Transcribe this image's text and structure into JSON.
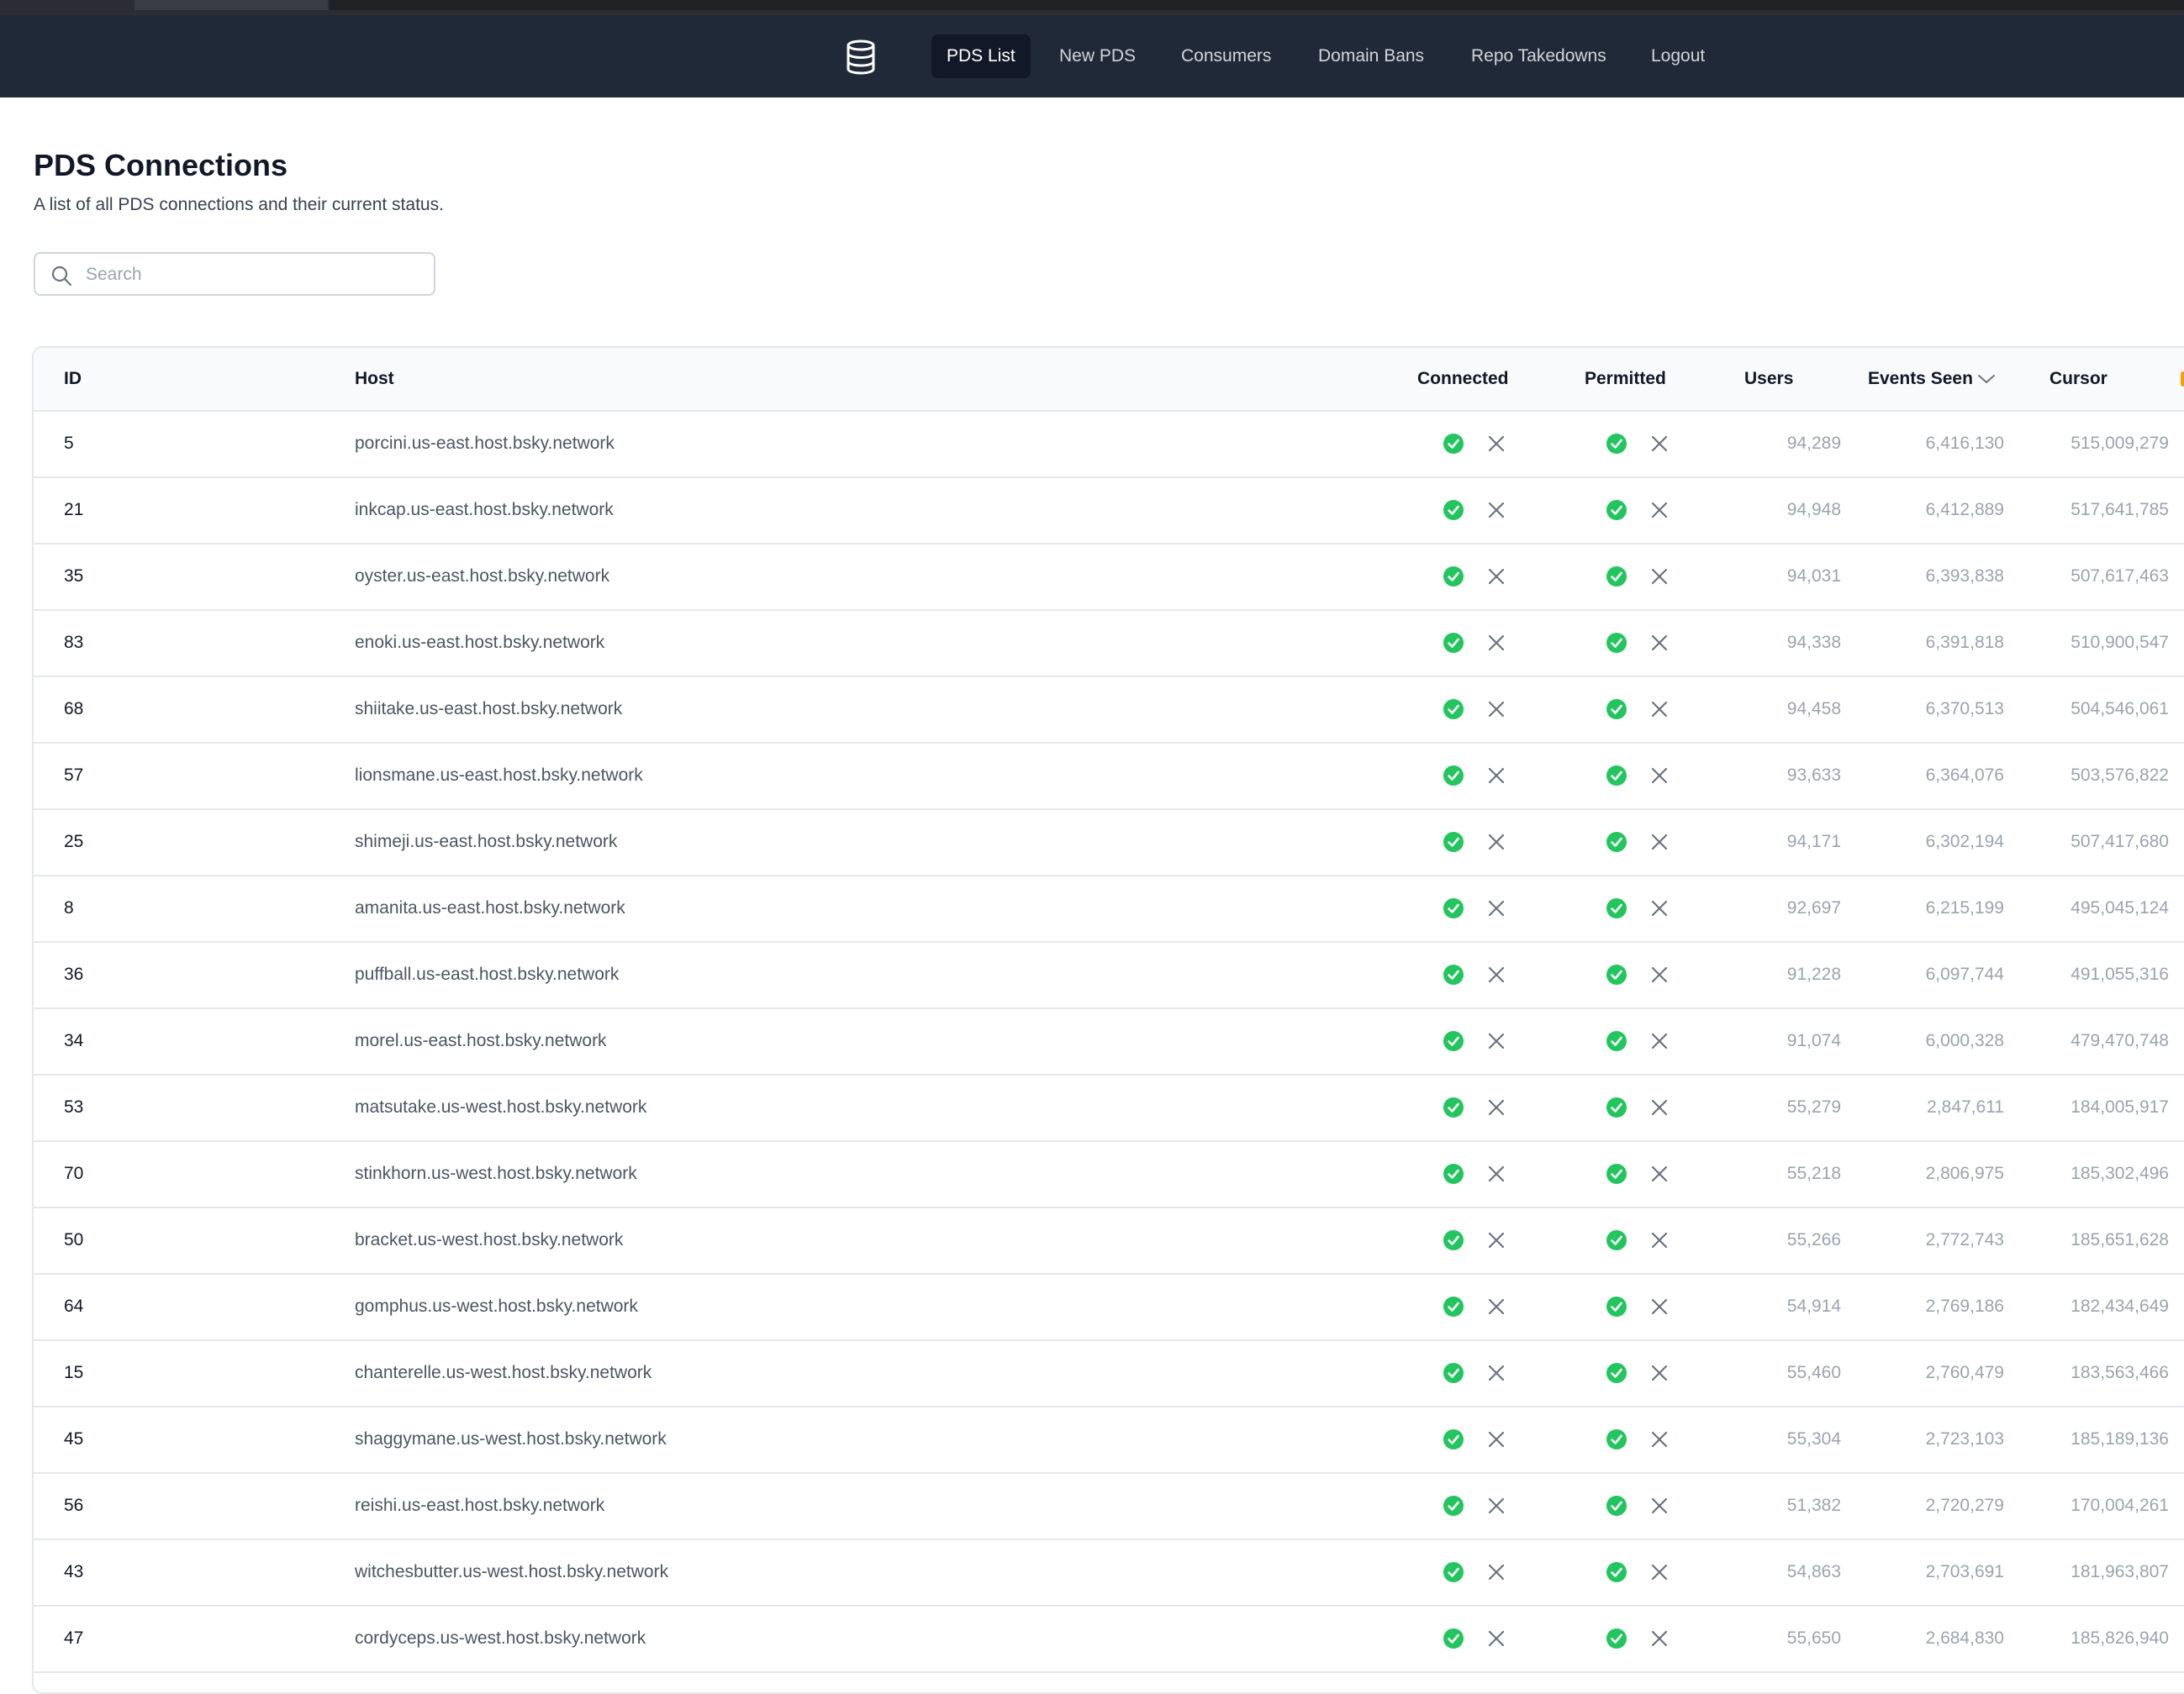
{
  "nav": {
    "items": [
      {
        "label": "PDS List",
        "active": true
      },
      {
        "label": "New PDS",
        "active": false
      },
      {
        "label": "Consumers",
        "active": false
      },
      {
        "label": "Domain Bans",
        "active": false
      },
      {
        "label": "Repo Takedowns",
        "active": false
      },
      {
        "label": "Logout",
        "active": false
      }
    ]
  },
  "page": {
    "title": "PDS Connections",
    "subtitle": "A list of all PDS connections and their current status."
  },
  "search": {
    "placeholder": "Search",
    "value": ""
  },
  "table": {
    "headers": {
      "id": "ID",
      "host": "Host",
      "connected": "Connected",
      "permitted": "Permitted",
      "users": "Users",
      "events_seen": "Events Seen",
      "cursor": "Cursor"
    },
    "sort_column": "events_seen",
    "sort_direction": "descending",
    "rows": [
      {
        "id": "5",
        "host": "porcini.us-east.host.bsky.network",
        "connected": true,
        "permitted": true,
        "users": "94,289",
        "events_seen": "6,416,130",
        "cursor": "515,009,279"
      },
      {
        "id": "21",
        "host": "inkcap.us-east.host.bsky.network",
        "connected": true,
        "permitted": true,
        "users": "94,948",
        "events_seen": "6,412,889",
        "cursor": "517,641,785"
      },
      {
        "id": "35",
        "host": "oyster.us-east.host.bsky.network",
        "connected": true,
        "permitted": true,
        "users": "94,031",
        "events_seen": "6,393,838",
        "cursor": "507,617,463"
      },
      {
        "id": "83",
        "host": "enoki.us-east.host.bsky.network",
        "connected": true,
        "permitted": true,
        "users": "94,338",
        "events_seen": "6,391,818",
        "cursor": "510,900,547"
      },
      {
        "id": "68",
        "host": "shiitake.us-east.host.bsky.network",
        "connected": true,
        "permitted": true,
        "users": "94,458",
        "events_seen": "6,370,513",
        "cursor": "504,546,061"
      },
      {
        "id": "57",
        "host": "lionsmane.us-east.host.bsky.network",
        "connected": true,
        "permitted": true,
        "users": "93,633",
        "events_seen": "6,364,076",
        "cursor": "503,576,822"
      },
      {
        "id": "25",
        "host": "shimeji.us-east.host.bsky.network",
        "connected": true,
        "permitted": true,
        "users": "94,171",
        "events_seen": "6,302,194",
        "cursor": "507,417,680"
      },
      {
        "id": "8",
        "host": "amanita.us-east.host.bsky.network",
        "connected": true,
        "permitted": true,
        "users": "92,697",
        "events_seen": "6,215,199",
        "cursor": "495,045,124"
      },
      {
        "id": "36",
        "host": "puffball.us-east.host.bsky.network",
        "connected": true,
        "permitted": true,
        "users": "91,228",
        "events_seen": "6,097,744",
        "cursor": "491,055,316"
      },
      {
        "id": "34",
        "host": "morel.us-east.host.bsky.network",
        "connected": true,
        "permitted": true,
        "users": "91,074",
        "events_seen": "6,000,328",
        "cursor": "479,470,748"
      },
      {
        "id": "53",
        "host": "matsutake.us-west.host.bsky.network",
        "connected": true,
        "permitted": true,
        "users": "55,279",
        "events_seen": "2,847,611",
        "cursor": "184,005,917"
      },
      {
        "id": "70",
        "host": "stinkhorn.us-west.host.bsky.network",
        "connected": true,
        "permitted": true,
        "users": "55,218",
        "events_seen": "2,806,975",
        "cursor": "185,302,496"
      },
      {
        "id": "50",
        "host": "bracket.us-west.host.bsky.network",
        "connected": true,
        "permitted": true,
        "users": "55,266",
        "events_seen": "2,772,743",
        "cursor": "185,651,628"
      },
      {
        "id": "64",
        "host": "gomphus.us-west.host.bsky.network",
        "connected": true,
        "permitted": true,
        "users": "54,914",
        "events_seen": "2,769,186",
        "cursor": "182,434,649"
      },
      {
        "id": "15",
        "host": "chanterelle.us-west.host.bsky.network",
        "connected": true,
        "permitted": true,
        "users": "55,460",
        "events_seen": "2,760,479",
        "cursor": "183,563,466"
      },
      {
        "id": "45",
        "host": "shaggymane.us-west.host.bsky.network",
        "connected": true,
        "permitted": true,
        "users": "55,304",
        "events_seen": "2,723,103",
        "cursor": "185,189,136"
      },
      {
        "id": "56",
        "host": "reishi.us-east.host.bsky.network",
        "connected": true,
        "permitted": true,
        "users": "51,382",
        "events_seen": "2,720,279",
        "cursor": "170,004,261"
      },
      {
        "id": "43",
        "host": "witchesbutter.us-west.host.bsky.network",
        "connected": true,
        "permitted": true,
        "users": "54,863",
        "events_seen": "2,703,691",
        "cursor": "181,963,807"
      },
      {
        "id": "47",
        "host": "cordyceps.us-west.host.bsky.network",
        "connected": true,
        "permitted": true,
        "users": "55,650",
        "events_seen": "2,684,830",
        "cursor": "185,826,940"
      }
    ]
  },
  "colors": {
    "nav_bg": "#1f2937",
    "nav_active_bg": "#111827",
    "status_ok": "#22c55e",
    "toggle_x": "#6b7280"
  },
  "icons": {
    "logo": "database-icon",
    "search": "search-icon",
    "sort": "chevron-down-icon",
    "ok": "check-circle-icon",
    "cancel": "x-icon"
  }
}
